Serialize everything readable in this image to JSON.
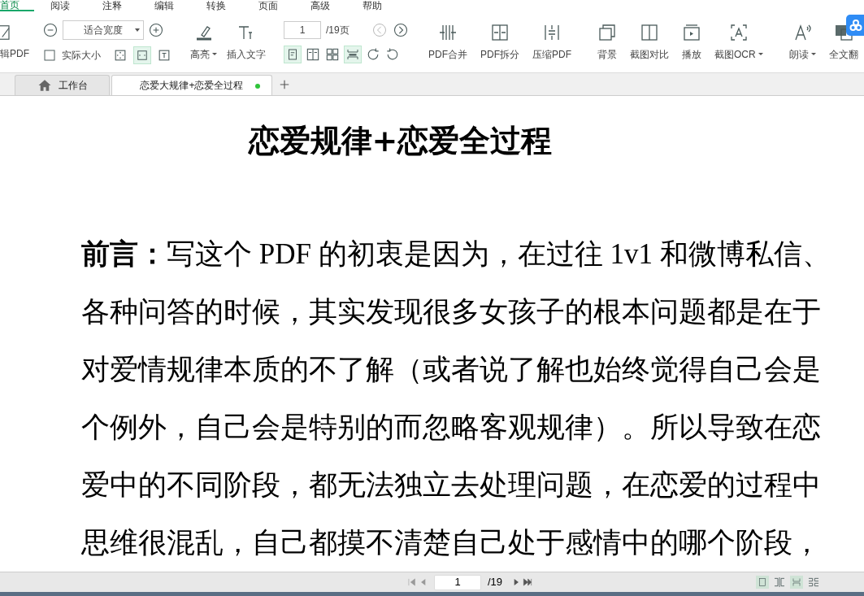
{
  "menu_tabs": [
    {
      "label": "首页",
      "selected": true
    },
    {
      "label": "阅读",
      "selected": false
    },
    {
      "label": "注释",
      "selected": false
    },
    {
      "label": "编辑",
      "selected": false
    },
    {
      "label": "转换",
      "selected": false
    },
    {
      "label": "页面",
      "selected": false
    },
    {
      "label": "高级",
      "selected": false
    },
    {
      "label": "帮助",
      "selected": false
    }
  ],
  "toolbar": {
    "edit_pdf": "辑PDF",
    "zoom_value": "适合宽度",
    "actual_size": "实际大小",
    "highlight": "高亮",
    "insert_text": "插入文字",
    "page_value": "1",
    "page_total": "/19页",
    "tools": [
      {
        "kind": "merge",
        "label": "PDF合并"
      },
      {
        "kind": "split",
        "label": "PDF拆分"
      },
      {
        "kind": "compress",
        "label": "压缩PDF"
      },
      {
        "kind": "background",
        "label": "背景"
      },
      {
        "kind": "compare",
        "label": "截图对比"
      },
      {
        "kind": "play",
        "label": "播放"
      },
      {
        "kind": "ocr",
        "label": "截图OCR"
      },
      {
        "kind": "read",
        "label": "朗读"
      },
      {
        "kind": "translate",
        "label": "全文翻"
      }
    ]
  },
  "doc_tabs": [
    {
      "label": "工作台",
      "kind": "home",
      "selected": false
    },
    {
      "label": "恋爱大规律+恋爱全过程",
      "kind": "doc",
      "selected": true
    }
  ],
  "document": {
    "title": "恋爱规律+恋爱全过程",
    "paragraph": "**前言：**写这个 PDF 的初衷是因为，在过往 1v1 和微博私信、各种问答的时候，其实发现很多女孩子的根本问题都是在于对爱情规律本质的不了解（或者说了解也始终觉得自己会是个例外，自己会是特别的而忽略客观规律）。所以导致在恋爱中的不同阶段，都无法独立去处理问题，在恋爱的过程中思维很混乱，自己都摸不清楚自己处于感情中的哪个阶段，"
  },
  "status_bar": {
    "page_value": "1",
    "page_total": "/19"
  }
}
